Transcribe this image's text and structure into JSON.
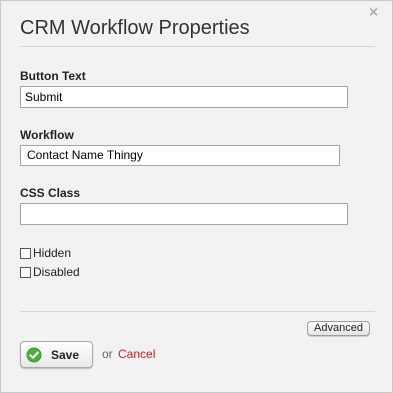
{
  "dialog": {
    "title": "CRM Workflow Properties",
    "close_glyph": "×"
  },
  "fields": {
    "button_text": {
      "label": "Button Text",
      "value": "Submit"
    },
    "workflow": {
      "label": "Workflow",
      "selected": "Contact Name Thingy"
    },
    "css_class": {
      "label": "CSS Class",
      "value": ""
    }
  },
  "options": {
    "hidden": {
      "label": "Hidden",
      "checked": false
    },
    "disabled": {
      "label": "Disabled",
      "checked": false
    }
  },
  "footer": {
    "advanced_label": "Advanced",
    "save_label": "Save",
    "or_label": "or",
    "cancel_label": "Cancel"
  },
  "colors": {
    "cancel": "#cc1f1f",
    "save_icon_green": "#3c9a2e",
    "background": "#f2f2f2"
  },
  "icons": {
    "close": "close-icon",
    "save": "checkmark-circle-icon",
    "select": "chevron-down-icon"
  }
}
